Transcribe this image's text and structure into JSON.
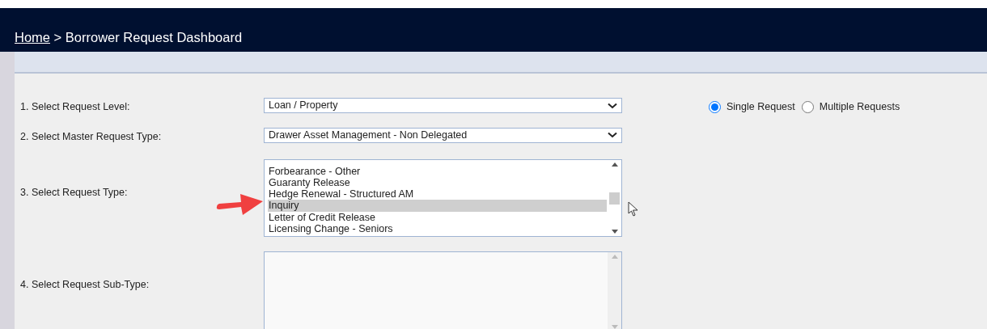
{
  "breadcrumb": {
    "home_link": "Home",
    "separator": ">",
    "current": "Borrower Request Dashboard"
  },
  "fields": [
    {
      "kind": "dropdown",
      "label": "1. Select Request Level:",
      "value": "Loan / Property"
    },
    {
      "kind": "dropdown",
      "label": "2. Select Master Request Type:",
      "value": "Drawer Asset Management - Non Delegated"
    },
    {
      "kind": "listbox",
      "label": "3. Select Request Type:",
      "items": [
        {
          "text": "Forbearance - Other",
          "selected": false
        },
        {
          "text": "Guaranty Release",
          "selected": false
        },
        {
          "text": "Hedge Renewal - Structured AM",
          "selected": false
        },
        {
          "text": "Inquiry",
          "selected": true
        },
        {
          "text": "Letter of Credit Release",
          "selected": false
        },
        {
          "text": "Licensing Change - Seniors",
          "selected": false
        }
      ]
    },
    {
      "kind": "listbox",
      "label": "4. Select Request Sub-Type:",
      "disabled": true
    }
  ],
  "request_mode": [
    {
      "label": "Single Request",
      "selected": true
    },
    {
      "label": "Multiple Requests",
      "selected": false
    }
  ]
}
